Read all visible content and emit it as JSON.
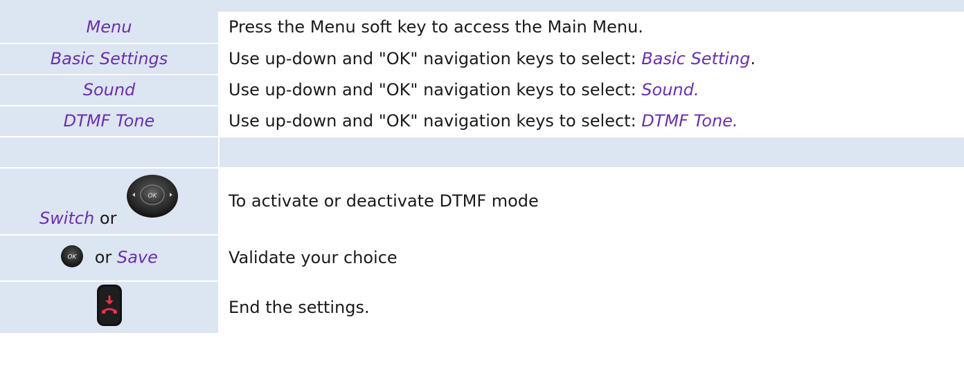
{
  "rows": [
    {
      "left": "Menu",
      "desc": "Press the Menu soft key to access the Main Menu."
    },
    {
      "left": "Basic Settings",
      "desc_prefix": "Use up-down and \"OK\" navigation keys to select: ",
      "desc_hl": "Basic Setting",
      "desc_suffix": "."
    },
    {
      "left": "Sound",
      "desc_prefix": "Use up-down and \"OK\" navigation keys to select: ",
      "desc_hl": "Sound."
    },
    {
      "left": "DTMF Tone",
      "desc_prefix": "Use up-down and \"OK\" navigation keys to select: ",
      "desc_hl": "DTMF Tone."
    },
    {
      "left": "",
      "desc": ""
    },
    {
      "left_hl": "Switch",
      "left_plain": "or",
      "icon": "navigation-ok-key-icon",
      "desc": "To activate or deactivate DTMF mode"
    },
    {
      "icon": "ok-key-icon",
      "left_plain": "or",
      "left_hl": "Save",
      "desc": "Validate your choice"
    },
    {
      "icon": "hang-up-key-icon",
      "desc": "End the settings."
    }
  ],
  "icon_labels": {
    "nav_ok": "OK",
    "ok": "OK"
  },
  "colors": {
    "highlight": "#6a2fb0",
    "cell_bg": "#dce5f2",
    "hangup_red": "#e8304a"
  }
}
